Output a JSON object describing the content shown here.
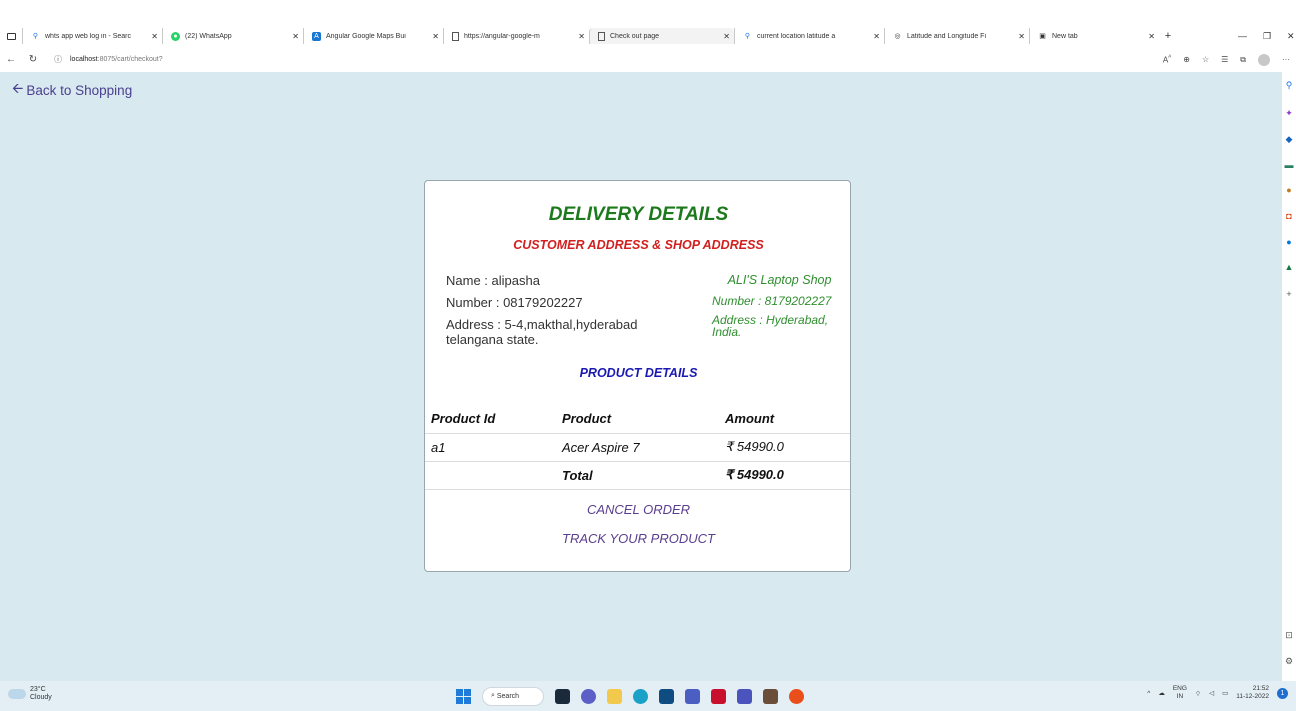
{
  "browser": {
    "tabs": [
      {
        "title": "whts app web log in - Searc",
        "icon": "search-icon",
        "active": false
      },
      {
        "title": "(22) WhatsApp",
        "icon": "whatsapp-icon",
        "active": false
      },
      {
        "title": "Angular Google Maps Bui",
        "icon": "angular-icon",
        "active": false
      },
      {
        "title": "https://angular-google-m",
        "icon": "page-icon",
        "active": false
      },
      {
        "title": "Check out page",
        "icon": "page-icon",
        "active": true
      },
      {
        "title": "current location latitude a",
        "icon": "search-icon",
        "active": false
      },
      {
        "title": "Latitude and Longitude Fi",
        "icon": "compass-icon",
        "active": false
      },
      {
        "title": "New tab",
        "icon": "newtab-icon",
        "active": false
      }
    ],
    "url_host": "localhost",
    "url_rest": ":8075/cart/checkout?"
  },
  "page": {
    "back_link": "Back to Shopping",
    "delivery_title": "DELIVERY DETAILS",
    "address_title": "CUSTOMER ADDRESS & SHOP ADDRESS",
    "customer": {
      "name": "Name : alipasha",
      "number": "Number : 08179202227",
      "address": "Address : 5-4,makthal,hyderabad telangana state."
    },
    "shop": {
      "name": "ALI'S Laptop Shop",
      "number": "Number : 8179202227",
      "address": "Address : Hyderabad, India."
    },
    "product_title": "PRODUCT DETAILS",
    "table": {
      "headers": [
        "Product Id",
        "Product",
        "Amount"
      ],
      "rows": [
        [
          "a1",
          "Acer Aspire 7",
          "₹ 54990.0"
        ]
      ],
      "total_label": "Total",
      "total_value": "₹ 54990.0"
    },
    "cancel_label": "CANCEL ORDER",
    "track_label": "TRACK YOUR PRODUCT"
  },
  "taskbar": {
    "temp": "23°C",
    "weather": "Cloudy",
    "search_label": "Search",
    "lang": "ENG",
    "region": "IN",
    "time": "21:52",
    "date": "11-12-2022"
  },
  "colors": {
    "page_bg": "#d8e9f0",
    "green": "#1c7a1c",
    "red": "#d21f1f",
    "blue": "#1a1ab3",
    "link_purple": "#5a3e8e"
  }
}
